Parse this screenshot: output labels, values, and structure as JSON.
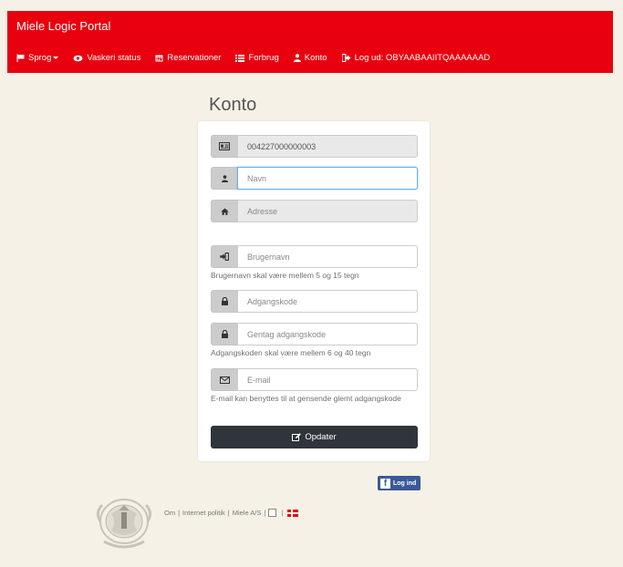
{
  "header": {
    "brand": "Miele Logic Portal",
    "nav": {
      "language": "Sprog",
      "laundry_status": "Vaskeri status",
      "reservations": "Reservationer",
      "consumption": "Forbrug",
      "account": "Konto",
      "logout": "Log ud: OBYAABAAIITQAAAAAAD"
    }
  },
  "page": {
    "title": "Konto"
  },
  "form": {
    "account_number": {
      "value": "004227000000003",
      "icon": "id-card-icon"
    },
    "name": {
      "placeholder": "Navn",
      "icon": "user-icon"
    },
    "address": {
      "placeholder": "Adresse",
      "icon": "home-icon"
    },
    "username": {
      "placeholder": "Brugernavn",
      "icon": "sign-in-icon",
      "help": "Brugernavn skal være mellem 5 og 15 tegn"
    },
    "password": {
      "placeholder": "Adgangskode",
      "icon": "lock-icon"
    },
    "password_repeat": {
      "placeholder": "Gentag adgangskode",
      "icon": "lock-icon",
      "help": "Adgangskoden skal være mellem 6 og 40 tegn"
    },
    "email": {
      "placeholder": "E-mail",
      "icon": "envelope-icon",
      "help": "E-mail kan benyttes til at gensende glemt adgangskode"
    },
    "submit_label": "Opdater"
  },
  "facebook": {
    "label": "Log ind"
  },
  "footer": {
    "about": "Om",
    "internet_policy": "Internet politik",
    "company": "Miele A/S"
  },
  "colors": {
    "brand_red": "#e8000f",
    "background": "#f5f1e6",
    "button_dark": "#2f353b",
    "facebook_blue": "#3b5998"
  }
}
